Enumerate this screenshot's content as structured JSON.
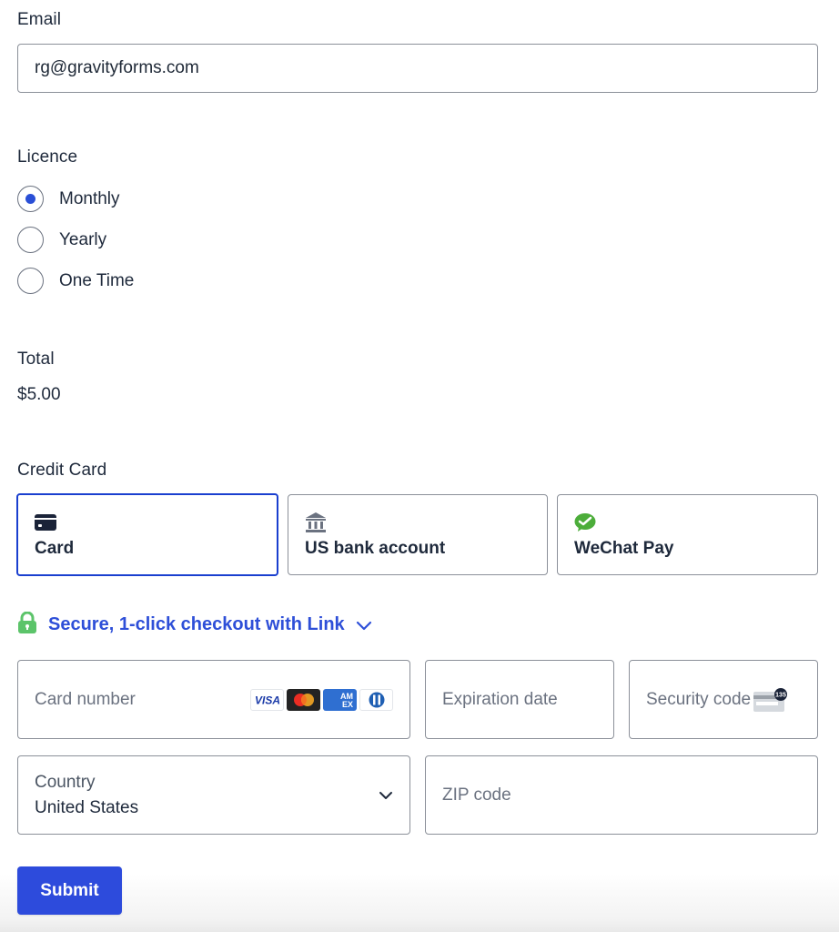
{
  "email": {
    "label": "Email",
    "value": "rg@gravityforms.com"
  },
  "licence": {
    "label": "Licence",
    "options": [
      {
        "label": "Monthly",
        "selected": true
      },
      {
        "label": "Yearly",
        "selected": false
      },
      {
        "label": "One Time",
        "selected": false
      }
    ]
  },
  "total": {
    "label": "Total",
    "value": "$5.00"
  },
  "credit_card": {
    "label": "Credit Card",
    "payment_methods": [
      {
        "label": "Card",
        "icon": "credit-card-icon",
        "active": true
      },
      {
        "label": "US bank account",
        "icon": "bank-icon",
        "active": false
      },
      {
        "label": "WeChat Pay",
        "icon": "wechat-icon",
        "active": false
      }
    ],
    "link_checkout": {
      "label": "Secure, 1-click checkout with Link",
      "icon": "lock-icon"
    },
    "card_number": {
      "placeholder": "Card number",
      "brands": [
        "VISA",
        "Mastercard",
        "AMEX",
        "Diners Club"
      ]
    },
    "expiration": {
      "placeholder": "Expiration date"
    },
    "security_code": {
      "placeholder": "Security code",
      "hint_digits": "135"
    },
    "country": {
      "label": "Country",
      "value": "United States"
    },
    "zip": {
      "placeholder": "ZIP code"
    }
  },
  "submit": {
    "label": "Submit"
  },
  "colors": {
    "accent": "#2d4bdc",
    "active_border": "#1a3fcf",
    "link_text": "#2e4fd8",
    "lock_green": "#5cc46a",
    "wechat_green": "#4cad3a",
    "text": "#1e293b",
    "placeholder": "#6b7280"
  }
}
